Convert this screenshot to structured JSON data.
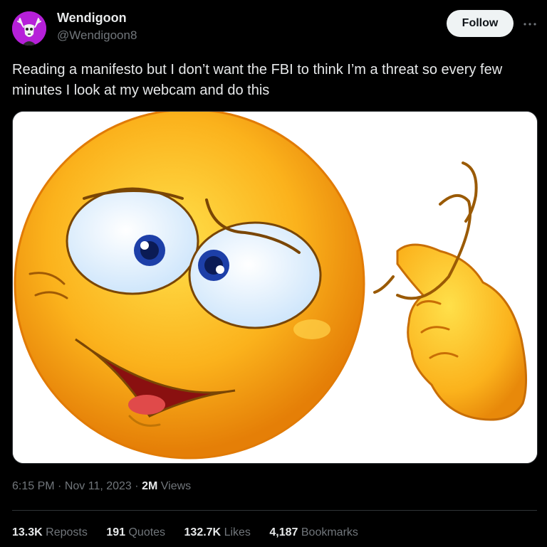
{
  "author": {
    "display_name": "Wendigoon",
    "handle": "@Wendigoon8",
    "avatar_icon": "wendigo-skull-avatar",
    "avatar_bg": "#b620d9"
  },
  "actions": {
    "follow_label": "Follow",
    "more_icon": "ellipsis-icon"
  },
  "tweet": {
    "text": "Reading a manifesto but I don’t want the FBI to think I’m a threat so every few minutes I look at my webcam and do this",
    "media_icon": "crazy-emoji-image"
  },
  "meta": {
    "time": "6:15 PM",
    "sep1": "·",
    "date": "Nov 11, 2023",
    "sep2": "·",
    "views_count": "2M",
    "views_label": "Views"
  },
  "stats": {
    "reposts": {
      "count": "13.3K",
      "label": "Reposts"
    },
    "quotes": {
      "count": "191",
      "label": "Quotes"
    },
    "likes": {
      "count": "132.7K",
      "label": "Likes"
    },
    "bookmarks": {
      "count": "4,187",
      "label": "Bookmarks"
    }
  },
  "colors": {
    "background": "#000000",
    "text_primary": "#e7e9ea",
    "text_secondary": "#71767b",
    "follow_bg": "#eff3f4",
    "border": "#2f3336"
  }
}
